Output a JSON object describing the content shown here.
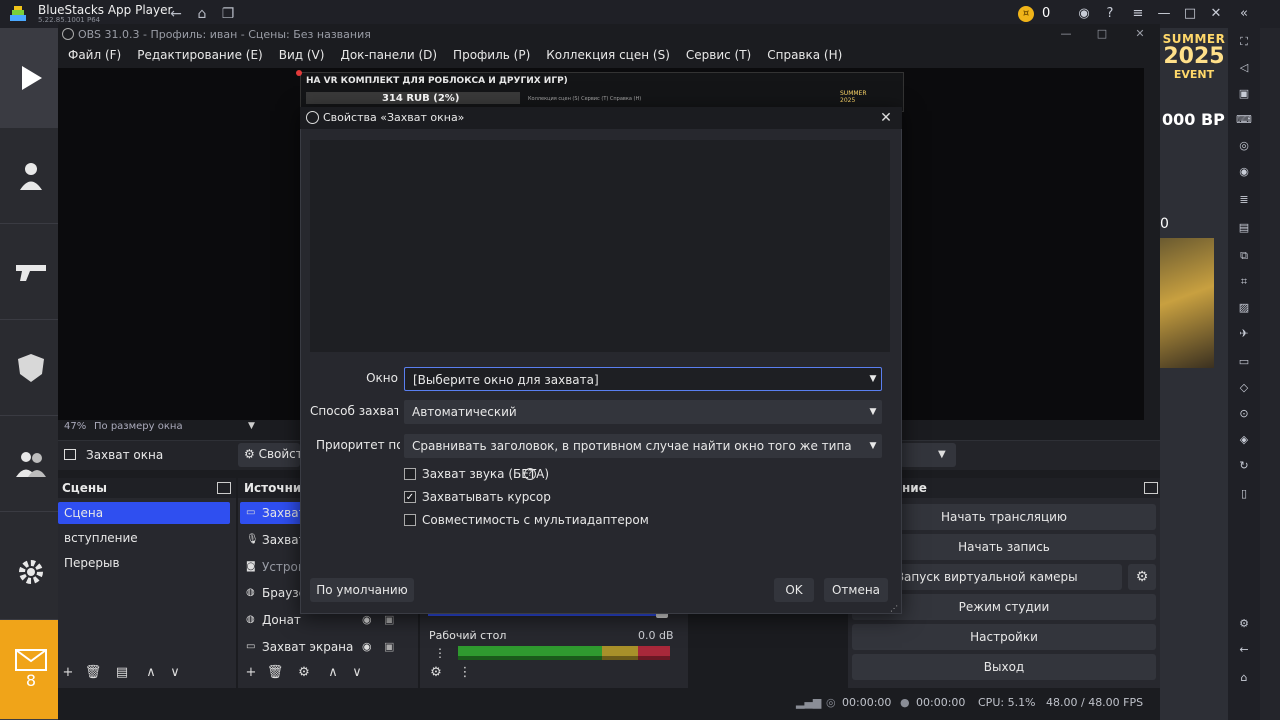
{
  "bluestacks": {
    "title": "BlueStacks App Player",
    "subtitle": "5.22.85.1001 P64",
    "coin_count": "0",
    "mail_count": "8",
    "colors": {
      "accent_orange": "#f0a419",
      "coin_gold": "#f0b419"
    }
  },
  "game": {
    "summer": "SUMMER",
    "year": "2025",
    "event": "EVENT",
    "bp": "000 BP",
    "zero": "0"
  },
  "obs": {
    "title": "OBS 31.0.3 - Профиль: иван - Сцены: Без названия",
    "menu": [
      "Файл (F)",
      "Редактирование (E)",
      "Вид (V)",
      "Док-панели (D)",
      "Профиль (P)",
      "Коллекция сцен (S)",
      "Сервис (T)",
      "Справка (H)"
    ],
    "preview_thumb": {
      "title": "НА VR КОМПЛЕКТ ДЛЯ РОБЛОКСА И ДРУГИХ ИГР)",
      "rub": "314 RUB (2%)",
      "menu": "Коллекция сцен (S)   Сервис (T)   Справка (H)",
      "summer": "SUMMER",
      "year": "2025"
    },
    "zoom": {
      "percent": "47%",
      "mode": "По размеру окна"
    },
    "source_bar": {
      "name": "Захват окна",
      "props_label": "Свойства"
    },
    "scenes": {
      "title": "Сцены",
      "items": [
        "Сцена",
        "вступление",
        "Перерыв"
      ]
    },
    "sources": {
      "title": "Источник",
      "items": [
        "Захват",
        "Захват",
        "Устрой",
        "Браузер",
        "Донат",
        "Захват экрана"
      ]
    },
    "mixer": {
      "track": "Рабочий стол",
      "db": "0.0 dB"
    },
    "controls": {
      "title": "ние",
      "buttons": [
        "Начать трансляцию",
        "Начать запись",
        "Запуск виртуальной камеры",
        "Режим студии",
        "Настройки",
        "Выход"
      ]
    },
    "status": {
      "stream_time": "00:00:00",
      "rec_time": "00:00:00",
      "cpu": "CPU: 5.1%",
      "fps": "48.00 / 48.00 FPS"
    },
    "colors": {
      "selection": "#2f4ff0",
      "meter_green": "#2f9a2f",
      "meter_yellow": "#a8902a",
      "meter_red": "#a8283a"
    }
  },
  "dialog": {
    "title": "Свойства «Захват окна»",
    "fields": {
      "window_label": "Окно",
      "window_value": "[Выберите окно для захвата]",
      "method_label": "Способ захвата",
      "method_value": "Автоматический",
      "priority_label": "Приоритет под",
      "priority_value": "Сравнивать заголовок, в противном случае найти окно того же типа"
    },
    "checkboxes": [
      {
        "label": "Захват звука (БЕТА)",
        "checked": false
      },
      {
        "label": "Захватывать курсор",
        "checked": true
      },
      {
        "label": "Совместимость с мультиадаптером",
        "checked": false
      }
    ],
    "buttons": {
      "defaults": "По умолчанию",
      "ok": "OK",
      "cancel": "Отмена"
    }
  }
}
